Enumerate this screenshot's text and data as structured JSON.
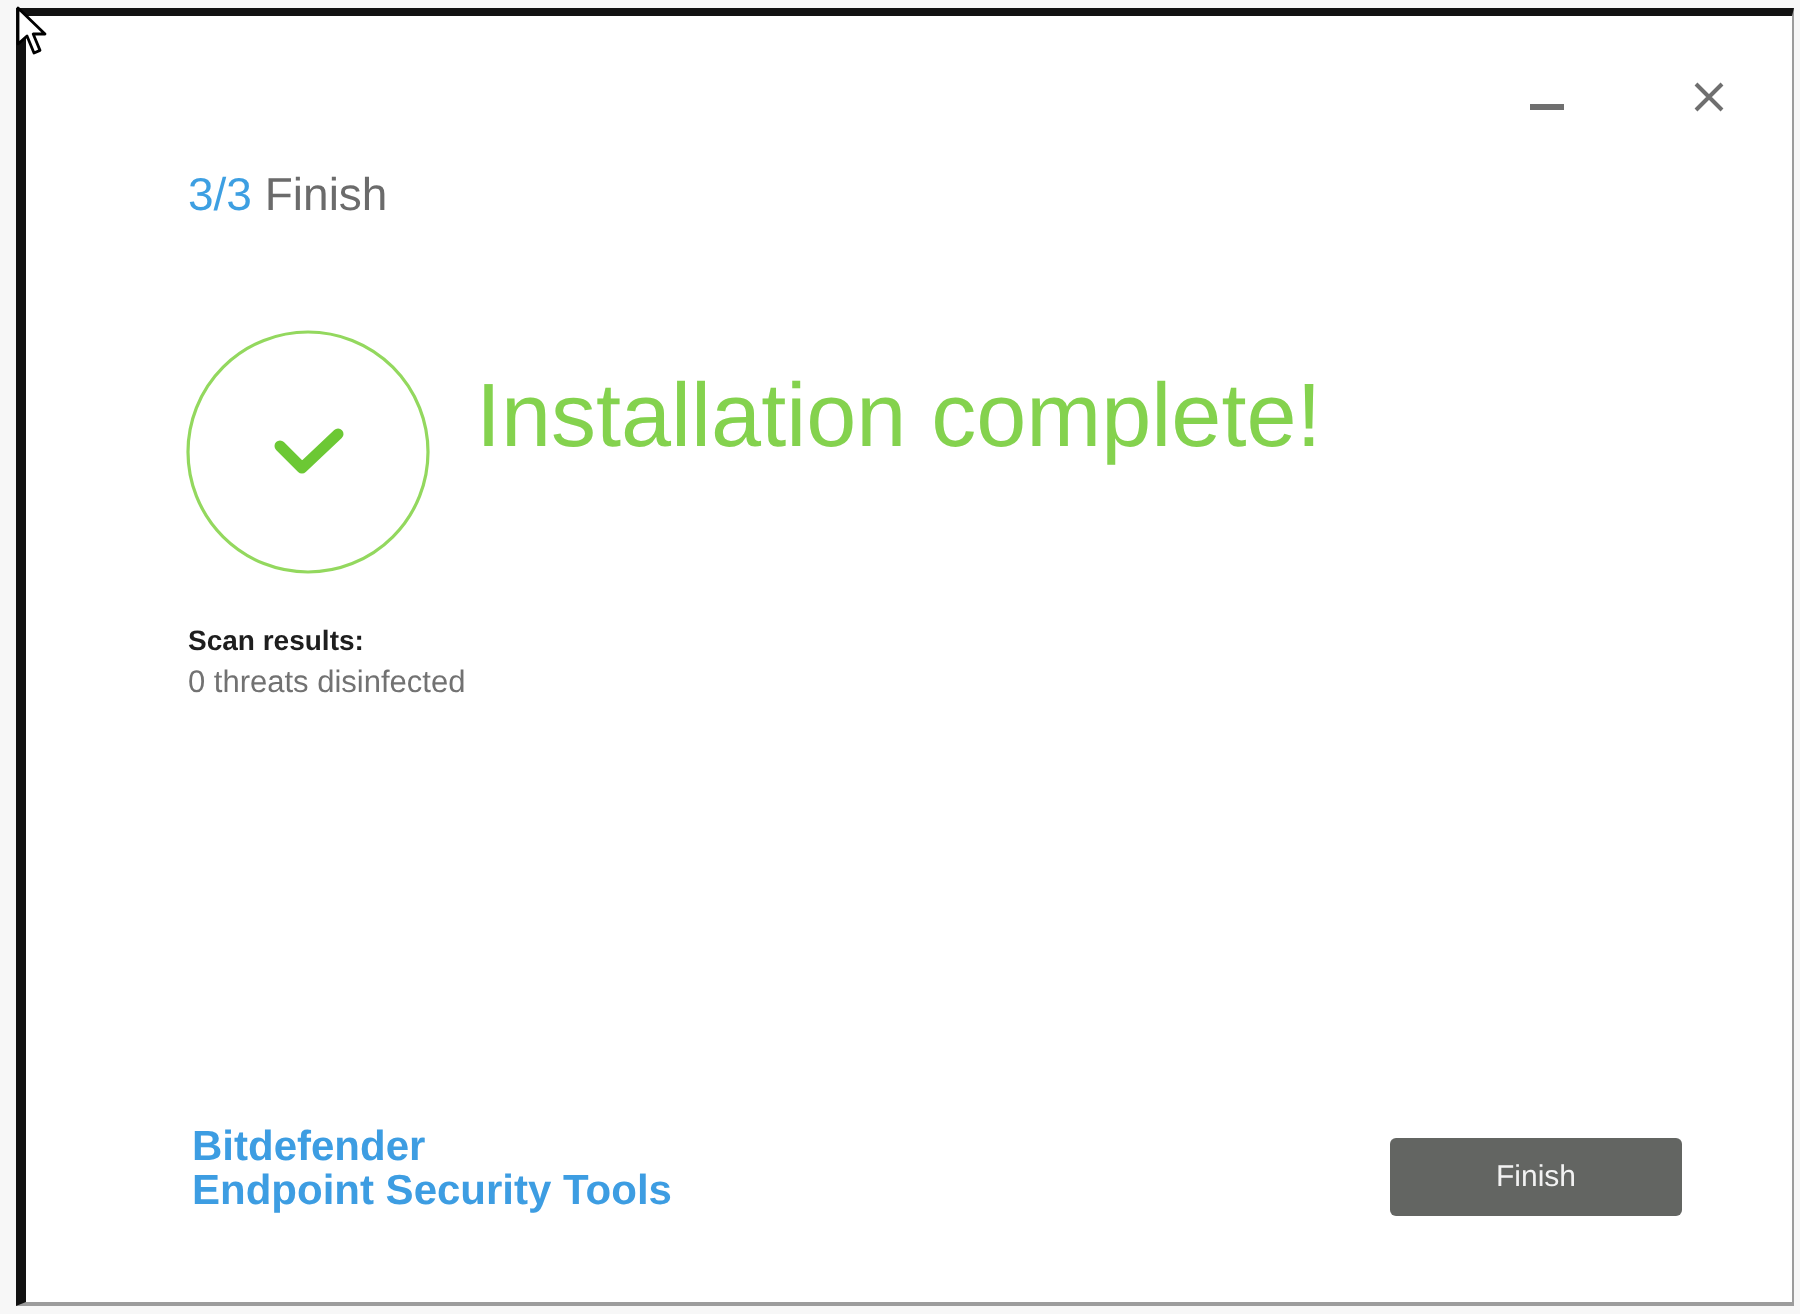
{
  "window": {
    "controls": [
      {
        "kind": "minimize"
      },
      {
        "kind": "close"
      }
    ]
  },
  "step": {
    "number": "3/3",
    "label": "Finish"
  },
  "result": {
    "title": "Installation complete!"
  },
  "scan": {
    "heading": "Scan results:",
    "summary": "0 threats disinfected"
  },
  "branding": {
    "brand": "Bitdefender",
    "product": "Endpoint Security Tools"
  },
  "buttons": [
    {
      "label": "Finish"
    }
  ]
}
